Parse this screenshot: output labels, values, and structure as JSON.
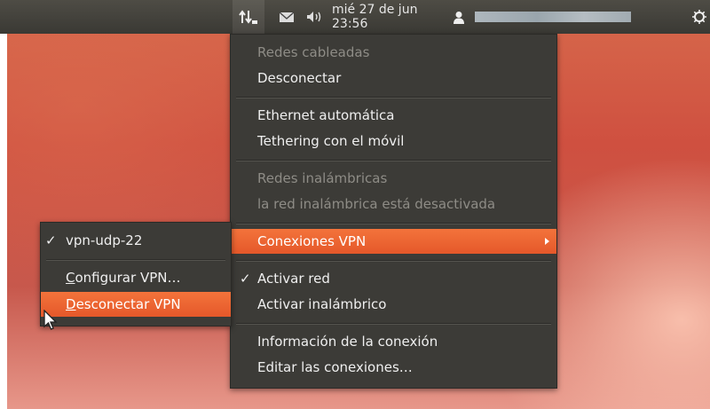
{
  "panel": {
    "network_icon": "network-updown-icon",
    "mail_icon": "mail-envelope-icon",
    "sound_icon": "speaker-volume-icon",
    "datetime": "mié 27 de jun 23:56",
    "user_icon": "user-icon",
    "power_icon": "gear-power-icon"
  },
  "network_menu": {
    "wired_header": "Redes cableadas",
    "disconnect": "Desconectar",
    "ethernet_auto": "Ethernet automática",
    "tethering": "Tethering con el móvil",
    "wireless_header": "Redes inalámbricas",
    "wireless_disabled": "la red inalámbrica está desactivada",
    "vpn_connections": "Conexiones VPN",
    "enable_network": "Activar red",
    "enable_wireless": "Activar inalámbrico",
    "connection_info": "Información de la conexión",
    "edit_connections": "Editar las conexiones…"
  },
  "vpn_menu": {
    "vpn_item": "vpn-udp-22",
    "configure_first": "C",
    "configure_rest": "onfigurar VPN…",
    "disconnect_first": "D",
    "disconnect_rest": "esconectar VPN"
  },
  "colors": {
    "accent": "#f07746",
    "menu_bg": "#3c3b37",
    "panel_bg": "#3f3e39"
  }
}
